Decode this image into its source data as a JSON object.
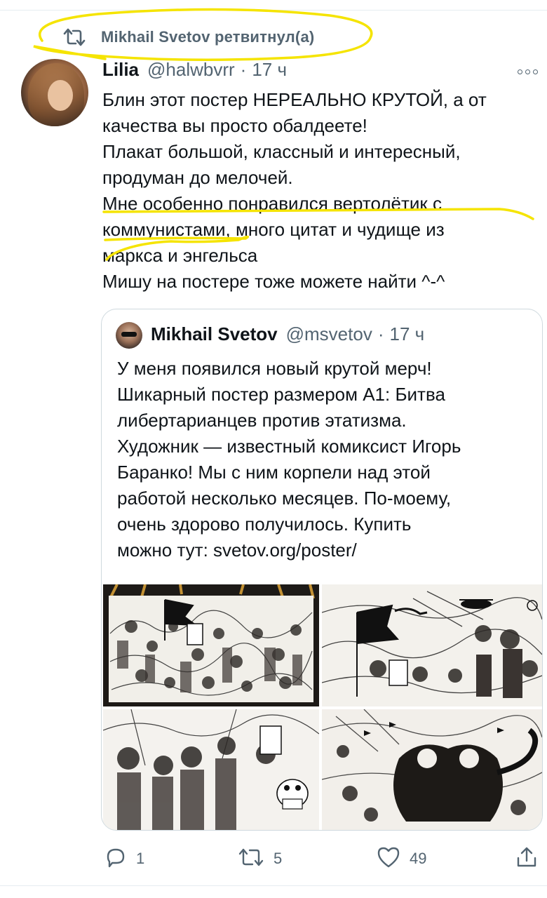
{
  "retweet": {
    "text": "Mikhail Svetov ретвитнул(а)"
  },
  "tweet": {
    "name": "Lilia",
    "handle": "@halwbvrr",
    "separator": "·",
    "time": "17 ч",
    "lines": [
      "Блин этот постер НЕРЕАЛЬНО КРУТОЙ, а от",
      "качества вы просто обалдеете!",
      "Плакат большой, классный и интересный,",
      "продуман до мелочей.",
      "Мне особенно понравился вертолётик с",
      "коммунистами, много цитат и чудище из",
      "маркса и энгельса",
      "Мишу на постере тоже можете найти ^-^"
    ]
  },
  "quote": {
    "name": "Mikhail Svetov",
    "handle": "@msvetov",
    "separator": "·",
    "time": "17 ч",
    "lines": [
      "У меня появился новый крутой мерч!",
      "Шикарный постер размером А1: Битва",
      "либертарианцев против этатизма.",
      "Художник — известный комиксист Игорь",
      "Баранко! Мы с ним корпели над этой",
      "работой несколько месяцев. По-моему,",
      "очень здорово получилось. Купить",
      "можно тут: svetov.org/poster/"
    ]
  },
  "actions": {
    "reply_count": "1",
    "retweet_count": "5",
    "like_count": "49"
  },
  "icons": {
    "retweet": "retweet-icon",
    "reply": "reply-icon",
    "like": "heart-icon",
    "share": "share-icon",
    "more": "more-icon"
  },
  "colors": {
    "text": "#0f1419",
    "secondary": "#536471",
    "border": "#cfd9de",
    "highlight": "#f5e400"
  }
}
